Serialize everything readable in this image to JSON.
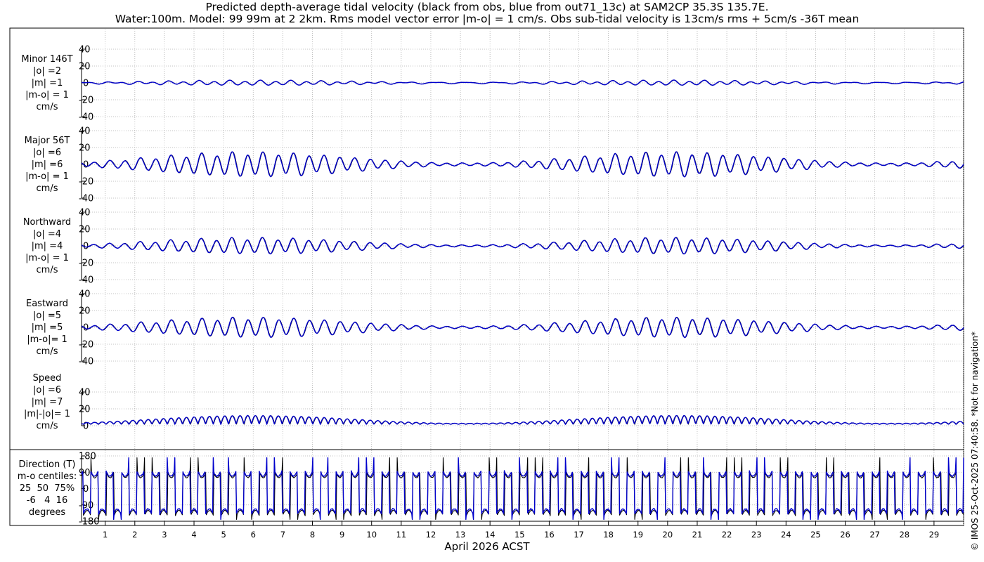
{
  "title": {
    "line1": "Predicted depth-average tidal velocity (black from obs, blue from out71_13c) at SAM2CP 35.3S 135.7E.",
    "line2": "Water:100m. Model: 99 99m at 2 2km. Rms model vector error |m-o| = 1 cm/s. Obs sub-tidal velocity is 13cm/s rms + 5cm/s -36T mean"
  },
  "watermark": "© IMOS 25-Oct-2025 07:40:58. *Not for navigation*",
  "x_axis_label": "April 2026 ACST",
  "colors": {
    "obs": "#000000",
    "model": "#0000cc",
    "grid": "#b0b0b0",
    "frame": "#000000"
  },
  "chart_data": {
    "type": "line",
    "series_names": [
      "obs",
      "model"
    ],
    "x": {
      "unit": "day of April 2026",
      "range": [
        0.2,
        30.0
      ],
      "ticks": [
        1,
        2,
        3,
        4,
        5,
        6,
        7,
        8,
        9,
        10,
        11,
        12,
        13,
        14,
        15,
        16,
        17,
        18,
        19,
        20,
        21,
        22,
        23,
        24,
        25,
        26,
        27,
        28,
        29
      ]
    },
    "panels": [
      {
        "label": [
          "Minor 146T",
          "|o| =2",
          "|m| =1",
          "|m-o| = 1",
          "cm/s"
        ],
        "ylim": [
          -40,
          40
        ],
        "yticks": [
          -40,
          -20,
          0,
          20,
          40
        ],
        "kind": "minor",
        "amplitude_rms": 2
      },
      {
        "label": [
          "Major 56T",
          "|o| =6",
          "|m| =6",
          "|m-o| = 1",
          "cm/s"
        ],
        "ylim": [
          -40,
          40
        ],
        "yticks": [
          -40,
          -20,
          0,
          20,
          40
        ],
        "kind": "major",
        "amplitude_rms": 6
      },
      {
        "label": [
          "Northward",
          "|o| =4",
          "|m| =4",
          "|m-o| = 1",
          "cm/s"
        ],
        "ylim": [
          -40,
          40
        ],
        "yticks": [
          -40,
          -20,
          0,
          20,
          40
        ],
        "kind": "north",
        "amplitude_rms": 4
      },
      {
        "label": [
          "Eastward",
          "|o| =5",
          "|m| =5",
          "|m-o|= 1",
          "cm/s"
        ],
        "ylim": [
          -40,
          40
        ],
        "yticks": [
          -40,
          -20,
          0,
          20,
          40
        ],
        "kind": "east",
        "amplitude_rms": 5
      },
      {
        "label": [
          "Speed",
          "|o| =6",
          "|m| =7",
          "|m|-|o|= 1",
          "cm/s"
        ],
        "ylim": [
          0,
          40
        ],
        "yticks": [
          0,
          20,
          40
        ],
        "kind": "speed",
        "amplitude_rms": 6
      },
      {
        "label": [
          "Direction (T)",
          "m-o centiles:",
          "25  50  75%",
          "-6   4  16",
          "degrees"
        ],
        "ylim": [
          -180,
          180
        ],
        "yticks": [
          -180,
          -90,
          0,
          90,
          180
        ],
        "kind": "direction"
      }
    ]
  }
}
